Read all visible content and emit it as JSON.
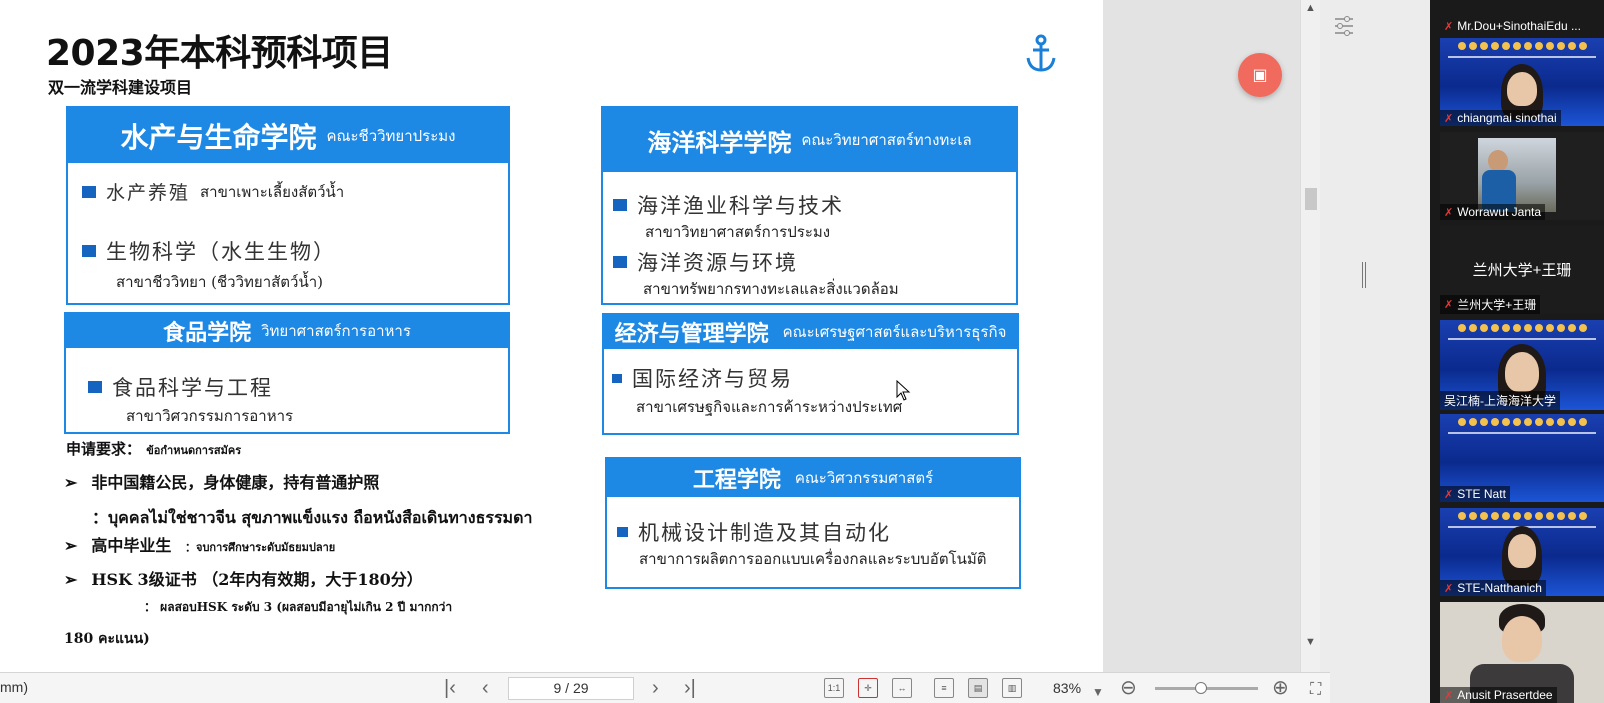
{
  "slide": {
    "title": "2023年本科预科项目",
    "subtitle": "双一流学科建设项目",
    "faculties": {
      "aquatic": {
        "zh": "水产与生命学院",
        "th": "คณะชีววิทยาประมง",
        "items": [
          {
            "zh": "水产养殖",
            "th": "สาขาเพาะเลี้ยงสัตว์น้ำ"
          },
          {
            "zh": "生物科学（水生生物）",
            "th": "สาขาชีววิทยา (ชีววิทยาสัตว์น้ำ)"
          }
        ]
      },
      "food": {
        "zh": "食品学院",
        "th": "วิทยาศาสตร์การอาหาร",
        "items": [
          {
            "zh": "食品科学与工程",
            "th": "สาขาวิศวกรรมการอาหาร"
          }
        ]
      },
      "ocean": {
        "zh": "海洋科学学院",
        "th": "คณะวิทยาศาสตร์ทางทะเล",
        "items": [
          {
            "zh": "海洋渔业科学与技术",
            "th": "สาขาวิทยาศาสตร์การประมง"
          },
          {
            "zh": "海洋资源与环境",
            "th": "สาขาทรัพยากรทางทะเลและสิ่งแวดล้อม"
          }
        ]
      },
      "economics": {
        "zh": "经济与管理学院",
        "th": "คณะเศรษฐศาสตร์และบริหารธุรกิจ",
        "items": [
          {
            "zh": "国际经济与贸易",
            "th": "สาขาเศรษฐกิจและการค้าระหว่างประเทศ"
          }
        ]
      },
      "engineering": {
        "zh": "工程学院",
        "th": "คณะวิศวกรรมศาสตร์",
        "items": [
          {
            "zh": "机械设计制造及其自动化",
            "th": "สาขาการผลิตการออกแบบเครื่องกลและระบบอัตโนมัติ"
          }
        ]
      }
    },
    "requirements": {
      "heading_zh": "申请要求：",
      "heading_th": "ข้อกำหนดการสมัคร",
      "r1_zh": "非中国籍公民，身体健康，持有普通护照",
      "r1_th": "：บุคคลไม่ใช่ชาวจีน สุขภาพแข็งแรง ถือหนังสือเดินทางธรรมดา",
      "r2_zh": "高中毕业生",
      "r2_th": "：จบการศึกษาระดับมัธยมปลาย",
      "r3_zh": "HSK 3级证书 （2年内有效期，大于180分）",
      "r3_th_a": "： ผลสอบHSK  ระดับ 3  (ผลสอบมีอายุไม่เกิน 2  ปี มากกว่า",
      "r3_th_b": "180  คะแนน)"
    }
  },
  "toolbar": {
    "left_text": "mm)",
    "page_display": "9 / 29",
    "zoom": "83%",
    "icons": [
      "first-page-icon",
      "prev-page-icon",
      "next-page-icon",
      "last-page-icon",
      "actual-size-icon",
      "fit-page-icon",
      "fit-width-icon",
      "continuous-icon",
      "single-page-icon",
      "two-page-icon",
      "zoom-out-icon",
      "zoom-in-icon",
      "fullscreen-icon"
    ]
  },
  "participants": [
    {
      "name": "Mr.Dou+SinothaiEdu ..."
    },
    {
      "name": "chiangmai sinothai"
    },
    {
      "name": "Worrawut Janta"
    },
    {
      "name": "兰州大学+王珊",
      "center_label": "兰州大学+王珊"
    },
    {
      "name": "吴江楠-上海海洋大学"
    },
    {
      "name": "STE Natt"
    },
    {
      "name": "STE-Natthanich"
    },
    {
      "name": "Anusit Prasertdee"
    }
  ],
  "colors": {
    "accent": "#1e88e5",
    "float_button": "#f06a5d",
    "active_speaker": "#e5e558",
    "muted_mic": "#e53935"
  }
}
